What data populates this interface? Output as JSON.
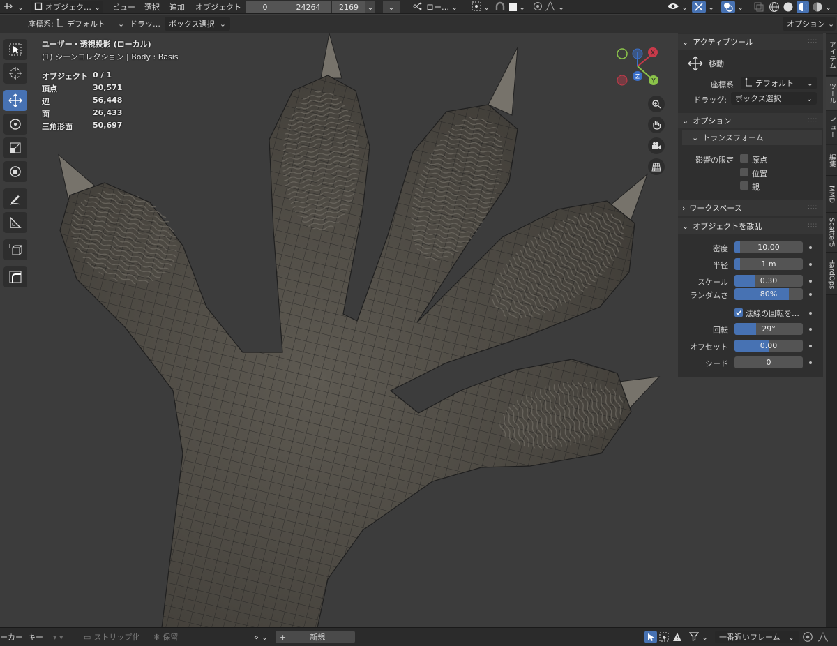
{
  "header": {
    "mode_label": "オブジェク…",
    "menu": [
      "ビュー",
      "選択",
      "追加",
      "オブジェクト"
    ],
    "fields": [
      "0",
      "24264",
      "2169"
    ],
    "pivot_label": "ロー…"
  },
  "toolbar": {
    "coord_label": "座標系:",
    "coord_value": "デフォルト",
    "drag_label": "ドラッ…",
    "drag_value": "ボックス選択",
    "options_label": "オプション"
  },
  "viewport_overlay": {
    "view_name": "ユーザー・透視投影 (ローカル)",
    "collection": "(1) シーンコレクション | Body : Basis",
    "stats": [
      {
        "label": "オブジェクト",
        "value": "0 / 1"
      },
      {
        "label": "頂点",
        "value": "30,571"
      },
      {
        "label": "辺",
        "value": "56,448"
      },
      {
        "label": "面",
        "value": "26,433"
      },
      {
        "label": "三角形面",
        "value": "50,697"
      }
    ]
  },
  "gizmo": {
    "x": "X",
    "y": "Y",
    "z": "Z"
  },
  "npanel": {
    "tabs": [
      "アイテム",
      "ツール",
      "ビュー",
      "編集",
      "MMD",
      "Scatter5",
      "HardOps"
    ],
    "active_tool": {
      "title": "アクティブツール",
      "tool_name": "移動",
      "coord_label": "座標系",
      "coord_value": "デフォルト",
      "drag_label": "ドラッグ:",
      "drag_value": "ボックス選択"
    },
    "options": {
      "title": "オプション",
      "transform_title": "トランスフォーム",
      "affect_label": "影響の限定",
      "affect_items": [
        "原点",
        "位置",
        "親"
      ]
    },
    "workspace": {
      "title": "ワークスペース"
    },
    "scatter": {
      "title": "オブジェクトを散乱",
      "density": {
        "label": "密度",
        "value": "10.00",
        "fill": 0.08
      },
      "radius": {
        "label": "半径",
        "value": "1 m",
        "fill": 0.08
      },
      "scale": {
        "label": "スケール",
        "value": "0.30",
        "fill": 0.3
      },
      "random": {
        "label": "ランダムさ",
        "value": "80%",
        "fill": 0.8
      },
      "normal_rot": {
        "label": "法線の回転を…",
        "checked": true
      },
      "rotation": {
        "label": "回転",
        "value": "29°",
        "fill": 0.32
      },
      "offset": {
        "label": "オフセット",
        "value": "0.00",
        "fill": 0.5
      },
      "seed": {
        "label": "シード",
        "value": "0",
        "fill": 0
      }
    }
  },
  "footer": {
    "marker_label": "ーカー",
    "key_label": "キー",
    "strip_label": "ストリップ化",
    "keep_label": "保留",
    "new_label": "新規",
    "snap_label": "一番近いフレーム"
  },
  "colors": {
    "accent": "#4772b3",
    "gizmo_x": "#c83a4a",
    "gizmo_y": "#8bc34a",
    "gizmo_z": "#3b6fc8"
  }
}
